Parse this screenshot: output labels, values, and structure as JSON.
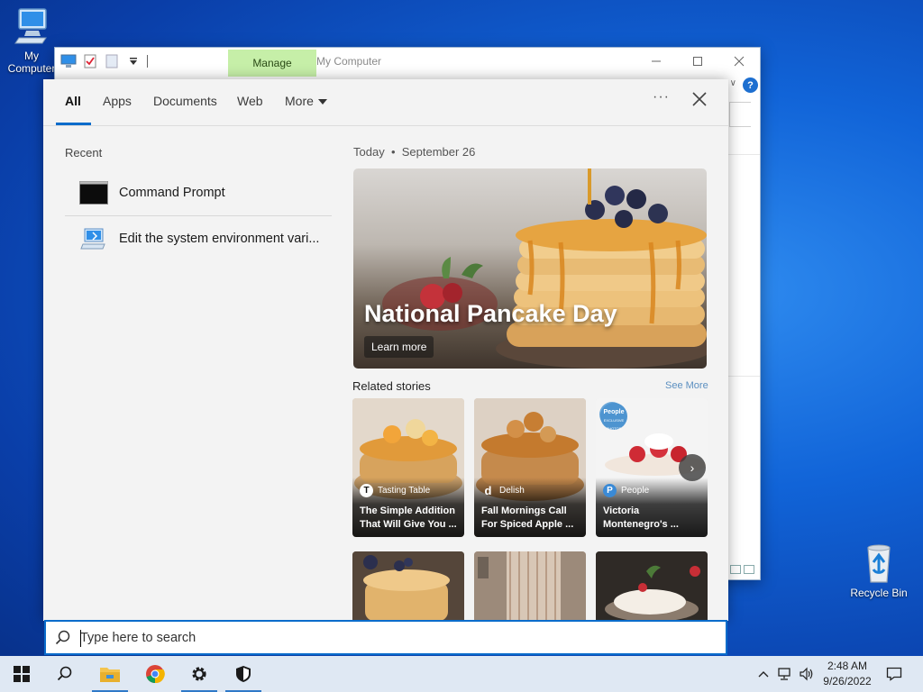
{
  "desktop": {
    "icons": [
      {
        "label": "My Computer",
        "icon": "computer-icon"
      },
      {
        "label": "Recycle Bin",
        "icon": "recycle-bin-icon"
      }
    ]
  },
  "explorer": {
    "title": "My Computer",
    "ribbon_tab": "Manage",
    "help_glyph": "?",
    "controls": {
      "minimize": "—",
      "maximize": "☐",
      "close": "✕"
    }
  },
  "search_panel": {
    "tabs": [
      {
        "label": "All",
        "active": true
      },
      {
        "label": "Apps"
      },
      {
        "label": "Documents"
      },
      {
        "label": "Web"
      },
      {
        "label": "More"
      }
    ],
    "options_glyph": "···",
    "recent": {
      "heading": "Recent",
      "items": [
        {
          "label": "Command Prompt",
          "icon": "command-prompt-icon"
        },
        {
          "label": "Edit the system environment vari...",
          "icon": "system-properties-icon"
        }
      ]
    },
    "today": {
      "prefix": "Today",
      "separator": "•",
      "date": "September 26"
    },
    "hero": {
      "title": "National Pancake Day",
      "button": "Learn more"
    },
    "related": {
      "heading": "Related stories",
      "see_more": "See More",
      "next_glyph": "›",
      "cards": [
        {
          "source": "Tasting Table",
          "badge": "T",
          "headline": "The Simple Addition That Will Give You ..."
        },
        {
          "source": "Delish",
          "badge": "d",
          "headline": "Fall Mornings Call For Spiced Apple ..."
        },
        {
          "source": "People",
          "badge": "P",
          "headline": "Victoria Montenegro's ...",
          "logo_text": "People",
          "logo_sub": "EXCLUSIVE PHOTOS"
        }
      ]
    }
  },
  "search": {
    "placeholder": "Type here to search"
  },
  "taskbar": {
    "clock": {
      "time": "2:48 AM",
      "date": "9/26/2022"
    },
    "tray_chevron": "^"
  },
  "colors": {
    "accent": "#0a6ccb",
    "manage_tab": "#c6efa8",
    "taskbar": "#dfe8f3"
  }
}
